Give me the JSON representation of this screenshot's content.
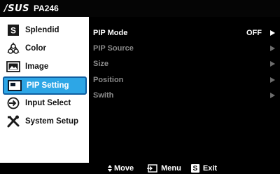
{
  "header": {
    "brand": "/SUS",
    "model": "PA246"
  },
  "sidebar": {
    "items": [
      {
        "label": "Splendid",
        "icon": "splendid-s-icon"
      },
      {
        "label": "Color",
        "icon": "color-palette-icon"
      },
      {
        "label": "Image",
        "icon": "image-icon"
      },
      {
        "label": "PIP Setting",
        "icon": "pip-icon",
        "selected": true
      },
      {
        "label": "Input Select",
        "icon": "input-select-icon"
      },
      {
        "label": "System Setup",
        "icon": "tools-icon"
      }
    ]
  },
  "main": {
    "rows": [
      {
        "label": "PIP Mode",
        "value": "OFF",
        "active": true
      },
      {
        "label": "PIP Source",
        "value": ""
      },
      {
        "label": "Size",
        "value": ""
      },
      {
        "label": "Position",
        "value": ""
      },
      {
        "label": "Swith",
        "value": ""
      }
    ]
  },
  "footer": {
    "move_label": "Move",
    "menu_label": "Menu",
    "exit_key": "S",
    "exit_label": "Exit"
  },
  "colors": {
    "selected_bg": "#2da6e6",
    "selected_border": "#0f5fa1",
    "panel_bg": "#000000",
    "sidebar_bg": "#ffffff",
    "dim_text": "#8a8a8a"
  }
}
